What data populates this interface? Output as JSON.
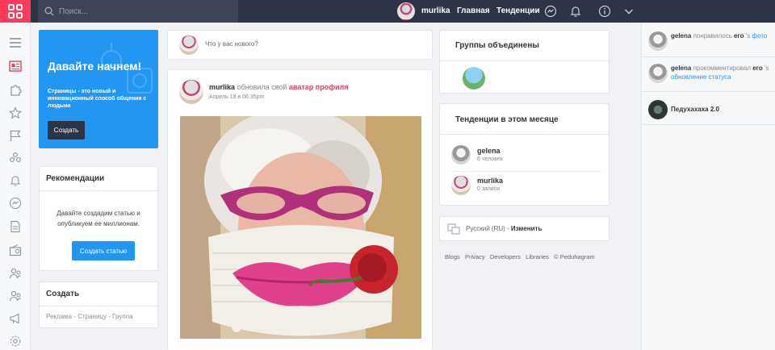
{
  "topbar": {
    "search_placeholder": "Поиск...",
    "username": "murlika",
    "nav_home": "Главная",
    "nav_trends": "Тенденции"
  },
  "promo": {
    "title": "Давайте начнем!",
    "text": "Страницы - это новый и инновационный способ общения с людьми",
    "button": "Создать"
  },
  "recommendations": {
    "title": "Рекомендации",
    "text": "Давайте создадим статью и опубликуем ее миллионам.",
    "button": "Создать статью"
  },
  "create": {
    "title": "Создать",
    "link_ad": "Реклама",
    "sep1": " - ",
    "link_page": "Страницу",
    "sep2": " - ",
    "link_group": "Группа"
  },
  "composer": {
    "placeholder": "Что у вас нового?"
  },
  "post": {
    "author": "murlika",
    "action": " обновила свой ",
    "action_link": "аватар профиля",
    "time": "Апрель 18 в 06:35pm"
  },
  "groups": {
    "title": "Группы объединены"
  },
  "trending": {
    "title": "Тенденции в этом месяце",
    "items": [
      {
        "name": "gelena",
        "meta": "6 человек"
      },
      {
        "name": "murlika",
        "meta": "0 записи"
      }
    ]
  },
  "language": {
    "label": "Русский (RU) - ",
    "change": "Изменить"
  },
  "footer": {
    "blogs": "Blogs",
    "privacy": "Privacy",
    "developers": "Developers",
    "libraries": "Libraries",
    "copyright": "© Peduhagram"
  },
  "notifications": [
    {
      "user": "gelena",
      "text": " понравилось ",
      "obj": "его",
      "extra": " 's ",
      "link": "фото"
    },
    {
      "user": "gelena",
      "text": " прокомментировал ",
      "obj": "его",
      "extra": " 's ",
      "link": "обновление статуса"
    }
  ],
  "side_group": {
    "name": "Педухахаха 2.0"
  },
  "colors": {
    "accent": "#ff3b5c",
    "primary": "#2196f3",
    "topbar": "#2d3446"
  }
}
